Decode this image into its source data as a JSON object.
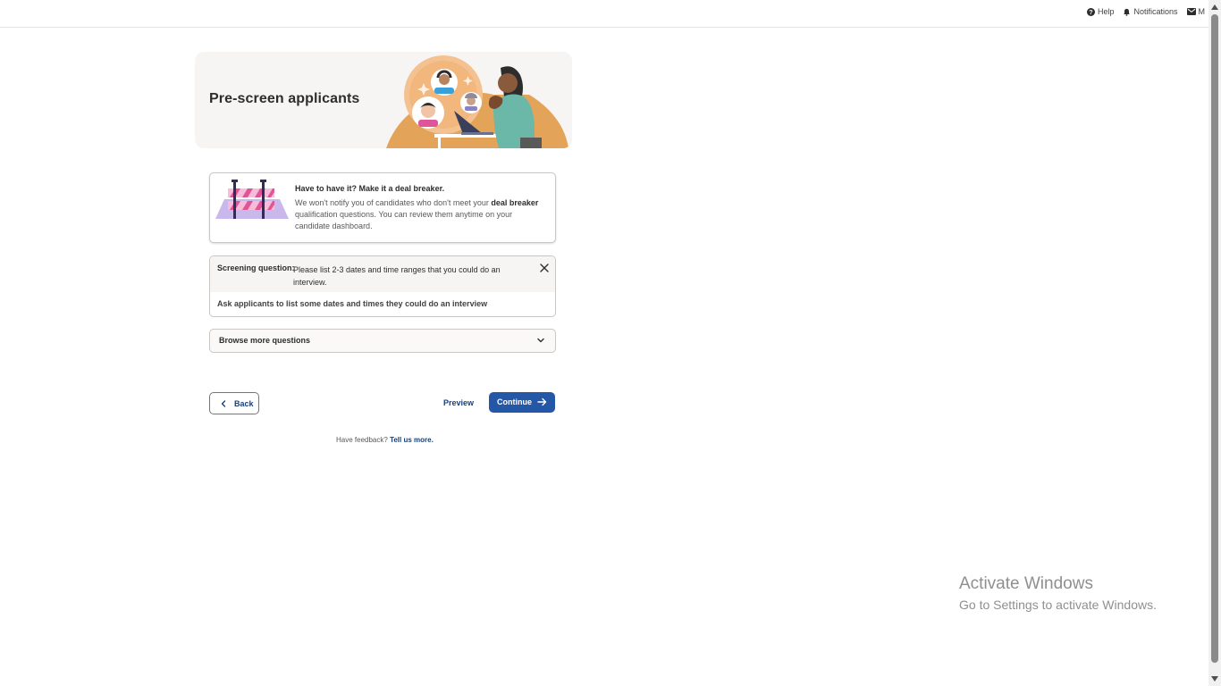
{
  "topbar": {
    "help_label": "Help",
    "notifications_label": "Notifications",
    "messages_label": "M"
  },
  "hero": {
    "title": "Pre-screen applicants"
  },
  "info_card": {
    "title": "Have to have it? Make it a deal breaker.",
    "body_before": "We won't notify you of candidates who don't meet your ",
    "body_bold": "deal breaker",
    "body_after": " qualification questions. You can review them anytime on your candidate dashboard."
  },
  "question": {
    "label": "Screening question:",
    "text": "Please list 2-3 dates and time ranges that you could do an interview.",
    "description": "Ask applicants to list some dates and times they could do an interview"
  },
  "browse": {
    "label": "Browse more questions"
  },
  "actions": {
    "back_label": "Back",
    "preview_label": "Preview",
    "continue_label": "Continue"
  },
  "feedback": {
    "prompt": "Have feedback?",
    "link": "Tell us more."
  },
  "watermark": {
    "title": "Activate Windows",
    "subtitle": "Go to Settings to activate Windows."
  },
  "colors": {
    "brand_blue": "#2557a7",
    "link_blue": "#164081",
    "hero_bg": "#f7f5f3",
    "accent_orange": "#e3a45a",
    "barrier_pink": "#e0559a",
    "barrier_lilac": "#c9b8ec"
  }
}
